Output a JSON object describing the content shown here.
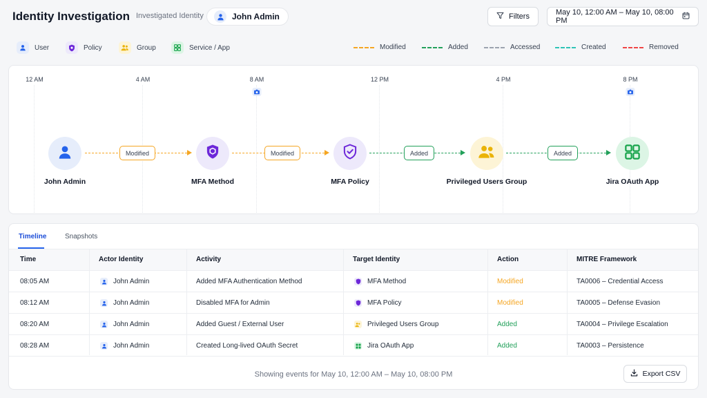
{
  "header": {
    "title": "Identity Investigation",
    "investigated_label": "Investigated Identity",
    "identity_name": "John Admin",
    "filters_label": "Filters",
    "date_range": "May 10, 12:00 AM – May 10, 08:00 PM"
  },
  "legend": {
    "types": [
      {
        "label": "User",
        "icon": "user-icon",
        "color": "#2563eb"
      },
      {
        "label": "Policy",
        "icon": "shield-icon",
        "color": "#6d28d9"
      },
      {
        "label": "Group",
        "icon": "users-icon",
        "color": "#eab308"
      },
      {
        "label": "Service / App",
        "icon": "grid-icon",
        "color": "#16a34a"
      }
    ],
    "lines": [
      {
        "label": "Modified",
        "color": "#f5a623"
      },
      {
        "label": "Added",
        "color": "#22a05a"
      },
      {
        "label": "Accessed",
        "color": "#9ca3af"
      },
      {
        "label": "Created",
        "color": "#2ec4b6"
      },
      {
        "label": "Removed",
        "color": "#ef4444"
      }
    ]
  },
  "timeline": {
    "hours": [
      "12 AM",
      "4 AM",
      "8 AM",
      "12 PM",
      "4 PM",
      "8 PM"
    ],
    "nodes": [
      {
        "label": "John Admin",
        "icon": "user-icon",
        "color": "#2563eb"
      },
      {
        "label": "MFA Method",
        "icon": "shield-icon",
        "color": "#6d28d9"
      },
      {
        "label": "MFA Policy",
        "icon": "shield-check-icon",
        "color": "#6d28d9"
      },
      {
        "label": "Privileged Users Group",
        "icon": "users-icon",
        "color": "#eab308"
      },
      {
        "label": "Jira OAuth App",
        "icon": "grid-icon",
        "color": "#16a34a"
      }
    ],
    "edges": [
      {
        "label": "Modified",
        "color": "#f5a623"
      },
      {
        "label": "Modified",
        "color": "#f5a623"
      },
      {
        "label": "Added",
        "color": "#22a05a"
      },
      {
        "label": "Added",
        "color": "#22a05a"
      }
    ]
  },
  "tabs": [
    "Timeline",
    "Snapshots"
  ],
  "table": {
    "columns": [
      "Time",
      "Actor Identity",
      "Activity",
      "Target Identity",
      "Action",
      "MITRE Framework"
    ],
    "rows": [
      {
        "time": "08:05 AM",
        "actor": "John Admin",
        "activity": "Added MFA Authentication Method",
        "target": "MFA Method",
        "target_icon": "shield-icon",
        "action": "Modified",
        "mitre": "TA0006 – Credential Access"
      },
      {
        "time": "08:12 AM",
        "actor": "John Admin",
        "activity": "Disabled MFA for Admin",
        "target": "MFA Policy",
        "target_icon": "shield-icon",
        "action": "Modified",
        "mitre": "TA0005 – Defense Evasion"
      },
      {
        "time": "08:20 AM",
        "actor": "John Admin",
        "activity": "Added Guest / External User",
        "target": "Privileged Users Group",
        "target_icon": "users-icon",
        "action": "Added",
        "mitre": "TA0004 – Privilege Escalation"
      },
      {
        "time": "08:28 AM",
        "actor": "John Admin",
        "activity": "Created Long-lived OAuth Secret",
        "target": "Jira OAuth App",
        "target_icon": "grid-icon",
        "action": "Added",
        "mitre": "TA0003 – Persistence"
      }
    ]
  },
  "footer": {
    "showing_text": "Showing events for May 10, 12:00 AM – May 10, 08:00 PM",
    "export_label": "Export CSV"
  },
  "colors": {
    "accent": "#2563eb",
    "modified": "#f5a623",
    "added": "#22a05a"
  }
}
